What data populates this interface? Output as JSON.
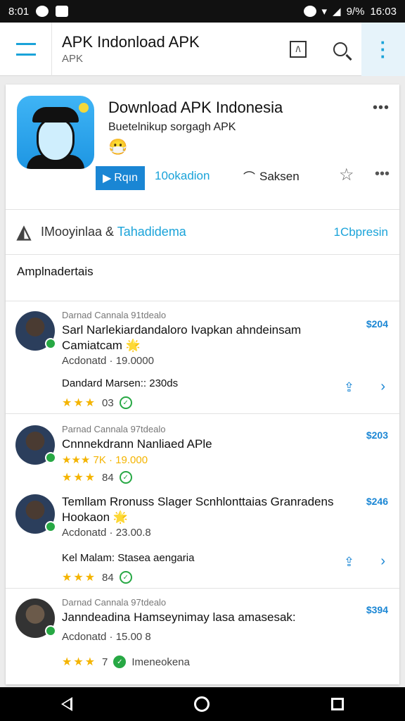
{
  "status": {
    "time_left": "8:01",
    "battery": "9/%",
    "clock": "16:03"
  },
  "app_bar": {
    "title": "APK Indonload APK",
    "subtitle": "APK"
  },
  "header": {
    "title": "Download APK Indonesia",
    "subtitle": "Buetelnikup sorgagh APK",
    "emoji": "😷",
    "run_label": "Rqın",
    "download_label": "10okadion",
    "share_label": "Saksen"
  },
  "developer": {
    "name": "IMooyinlaa &",
    "accent": "Tahadidema",
    "right": "1Cbpresin"
  },
  "section": {
    "title": "Amplnadertais"
  },
  "items": [
    {
      "meta": "Darnad Cannala 91tdealo",
      "title": "Sarl Narlekiardandaloro Ivapkan ahndeinsam Camiatcam 🌟",
      "line1": "Acdonatd · 19.0000",
      "line2": "Dandard Marsen:: 230ds",
      "price": "$204",
      "stars": "★★★",
      "rating": "03"
    },
    {
      "meta": "Parnad Cannala 97tdealo",
      "title": "Cnnnekdrann Nanliaed APle",
      "line1": "★★★ 7K · 19.000",
      "line2": "",
      "price": "$203",
      "stars": "★★★",
      "rating": "84"
    },
    {
      "meta": "",
      "title": "Temllam Rronuss Slager Scnhlonttaias Granradens Hookaon 🌟",
      "line1": "Acdonatd · 23.00.8",
      "line2": "Kel Malam: Stasea aengaria",
      "price": "$246",
      "stars": "★★★",
      "rating": "84"
    },
    {
      "meta": "Darnad Cannala 97tdealo",
      "title": "Janndeadina Hamseynimay lasa amasesak:",
      "line1": "Acdonatd · 15.00 8",
      "line2": "",
      "price": "$394",
      "stars": "★★★",
      "rating": "7",
      "extra": "Imeneokena"
    }
  ],
  "colors": {
    "accent": "#1aa3d9",
    "button": "#1a86d4",
    "star": "#f4b400",
    "verified": "#27a844"
  }
}
